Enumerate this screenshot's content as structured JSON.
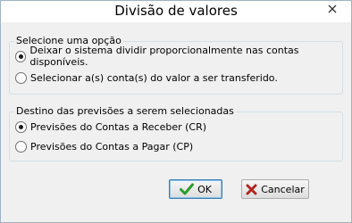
{
  "window": {
    "title": "Divisão de valores"
  },
  "group_option": {
    "label": "Selecione uma opção",
    "options": [
      {
        "label": "Deixar o sistema dividir proporcionalmente nas contas disponíveis.",
        "checked": true
      },
      {
        "label": "Selecionar a(s) conta(s) do valor a ser transferido.",
        "checked": false
      }
    ]
  },
  "group_destino": {
    "label": "Destino das previsões a serem selecionadas",
    "options": [
      {
        "label": "Previsões do Contas a Receber (CR)",
        "checked": true
      },
      {
        "label": "Previsões do Contas a Pagar (CP)",
        "checked": false
      }
    ]
  },
  "buttons": {
    "ok_label": "OK",
    "cancel_label": "Cancelar"
  },
  "icons": {
    "ok": "check-icon",
    "cancel": "x-icon",
    "close": "close-icon"
  },
  "colors": {
    "ok_check": "#2a9d2a",
    "cancel_x": "#b3261e"
  }
}
